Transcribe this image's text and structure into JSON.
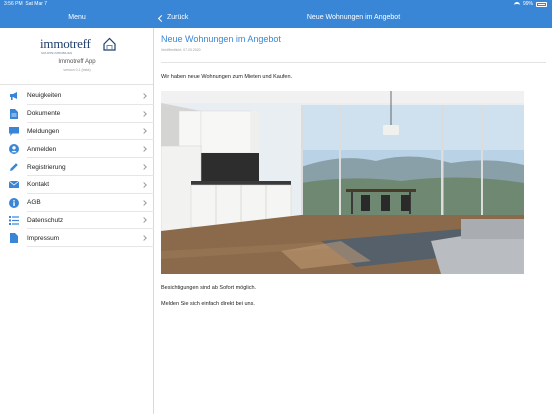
{
  "status_bar": {
    "time": "3:56 PM",
    "date": "Sat Mar 7",
    "battery": "99%"
  },
  "sidebar": {
    "header_title": "Menu",
    "logo_text": "immotreff",
    "logo_sub": "GRUPPE IMMOBILIEN",
    "app_name": "Immotreff App",
    "app_version": "version 0.1 (beta)",
    "items": [
      {
        "label": "Neuigkeiten",
        "icon": "megaphone-icon"
      },
      {
        "label": "Dokumente",
        "icon": "document-icon"
      },
      {
        "label": "Meldungen",
        "icon": "chat-bubble-icon"
      },
      {
        "label": "Anmelden",
        "icon": "user-icon"
      },
      {
        "label": "Registrierung",
        "icon": "pencil-icon"
      },
      {
        "label": "Kontakt",
        "icon": "envelope-icon"
      },
      {
        "label": "AGB",
        "icon": "info-icon"
      },
      {
        "label": "Datenschutz",
        "icon": "list-icon"
      },
      {
        "label": "Impressum",
        "icon": "file-icon"
      }
    ]
  },
  "nav": {
    "back_label": "Zurück",
    "title": "Neue Wohnungen im Angebot"
  },
  "article": {
    "title": "Neue Wohnungen im Angebot",
    "published": "Veröffentlicht: 07.03.2020",
    "intro": "Wir haben neue Wohnungen zum Mieten und Kaufen.",
    "line2": "Besichtigungen sind ab Sofort möglich.",
    "line3": "Melden Sie sich einfach direkt bei uns."
  },
  "colors": {
    "accent": "#3a86d6",
    "logo": "#1f3f6e"
  }
}
